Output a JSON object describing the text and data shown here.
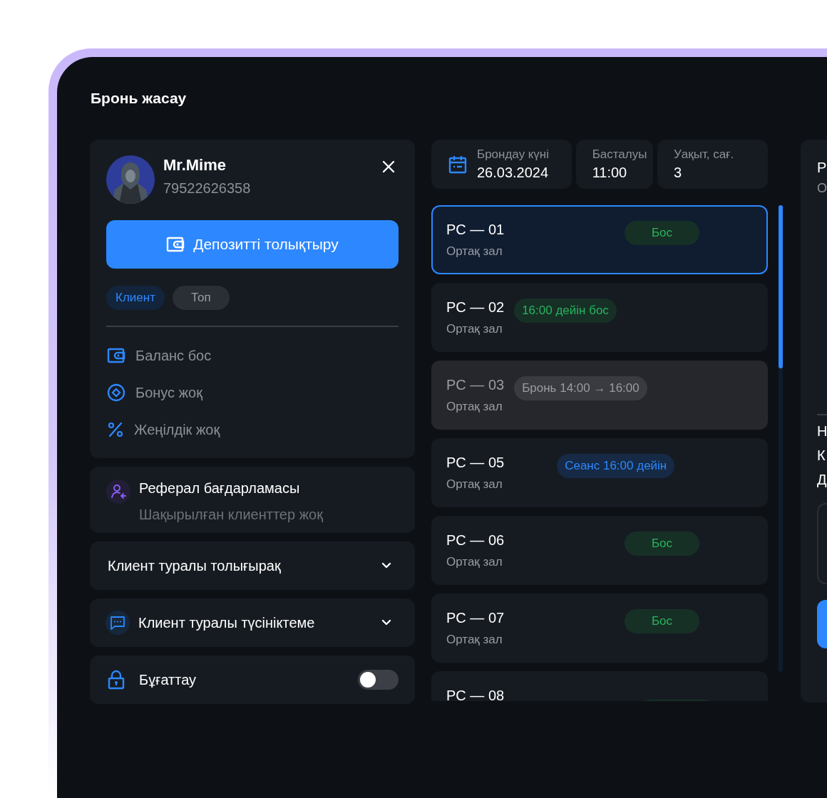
{
  "title": "Бронь жасау",
  "client": {
    "name": "Mr.Mime",
    "phone": "79522626358",
    "deposit_button": "Депозитті толықтыру",
    "tags": [
      {
        "label": "Клиент",
        "selected": true
      },
      {
        "label": "Топ",
        "selected": false
      }
    ],
    "facts": [
      {
        "kind": "wallet",
        "text": "Баланс бос"
      },
      {
        "kind": "bonus",
        "text": "Бонус жоқ"
      },
      {
        "kind": "discount",
        "text": "Жеңілдік жоқ"
      }
    ]
  },
  "referral": {
    "title": "Реферал бағдарламасы",
    "subtitle": "Шақырылған клиенттер жоқ"
  },
  "sections": [
    {
      "kind": "plain",
      "label": "Клиент туралы толығырақ",
      "expanded": false
    },
    {
      "kind": "comment",
      "label": "Клиент туралы түсініктеме",
      "expanded": false
    }
  ],
  "block": {
    "label": "Бұғаттау",
    "on": false
  },
  "booking_fields": [
    {
      "kind": "date",
      "label": "Брондау күні",
      "value": "26.03.2024"
    },
    {
      "kind": "plain",
      "label": "Басталуы",
      "value": "11:00"
    },
    {
      "kind": "plain",
      "label": "Уақыт, сағ.",
      "value": "3"
    }
  ],
  "pcs": [
    {
      "name": "PC — 01",
      "zone": "Ортақ зал",
      "status": "Бос",
      "kind": "free",
      "selected": true
    },
    {
      "name": "PC — 02",
      "zone": "Ортақ зал",
      "status": "16:00 дейін бос",
      "kind": "free",
      "selected": false
    },
    {
      "name": "PC — 03",
      "zone": "Ортақ зал",
      "status": "Бронь 14:00 → 16:00",
      "kind": "booked",
      "selected": false
    },
    {
      "name": "PC — 05",
      "zone": "Ортақ зал",
      "status": "Сеанс 16:00 дейін",
      "kind": "session",
      "selected": false
    },
    {
      "name": "PC — 06",
      "zone": "Ортақ зал",
      "status": "Бос",
      "kind": "free",
      "selected": false
    },
    {
      "name": "PC — 07",
      "zone": "Ортақ зал",
      "status": "Бос",
      "kind": "free",
      "selected": false
    },
    {
      "name": "PC — 08",
      "kind": "free",
      "selected": false
    }
  ],
  "right_panel": {
    "title": "Р",
    "subtitle": "О",
    "lines": [
      "Н",
      "К",
      "Д"
    ]
  }
}
